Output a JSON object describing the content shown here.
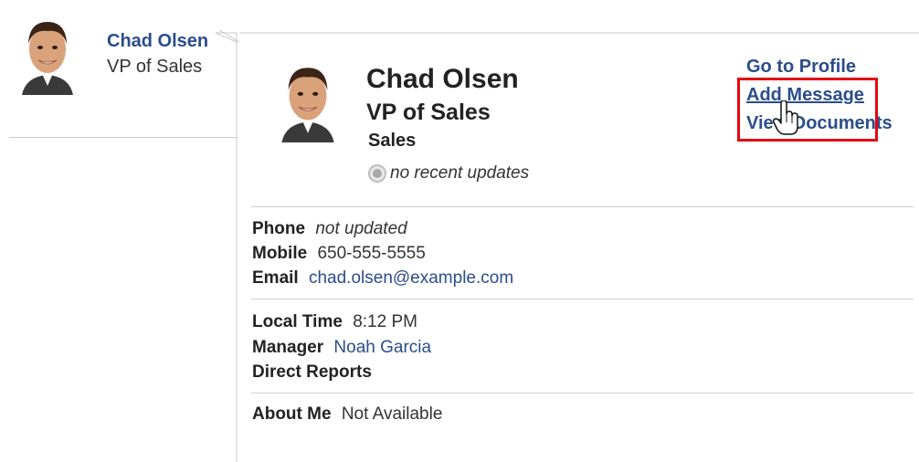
{
  "mini_card": {
    "name": "Chad Olsen",
    "title": "VP of Sales"
  },
  "popup": {
    "name": "Chad Olsen",
    "title": "VP of Sales",
    "department": "Sales",
    "status": "no recent updates",
    "actions": {
      "go_to_profile": "Go to Profile",
      "add_message": "Add Message",
      "view_documents": "View Documents"
    },
    "contact": {
      "phone_label": "Phone",
      "phone_value": "not updated",
      "mobile_label": "Mobile",
      "mobile_value": "650-555-5555",
      "email_label": "Email",
      "email_value": "chad.olsen@example.com"
    },
    "details": {
      "local_time_label": "Local Time",
      "local_time_value": "8:12 PM",
      "manager_label": "Manager",
      "manager_value": "Noah Garcia",
      "direct_reports_label": "Direct Reports"
    },
    "about": {
      "label": "About Me",
      "value": "Not Available"
    }
  },
  "colors": {
    "link": "#2b4d8c",
    "highlight": "#e30613"
  },
  "icons": {
    "status": "status-circle-icon",
    "cursor": "hand-pointer-icon"
  }
}
